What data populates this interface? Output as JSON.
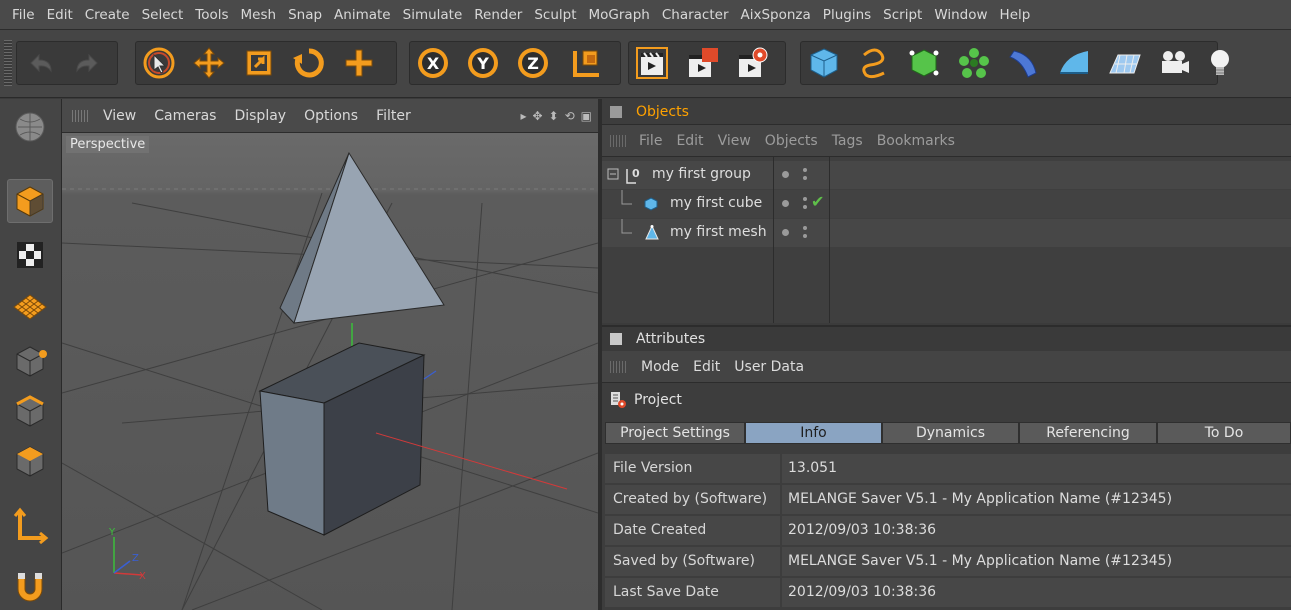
{
  "menubar": [
    "File",
    "Edit",
    "Create",
    "Select",
    "Tools",
    "Mesh",
    "Snap",
    "Animate",
    "Simulate",
    "Render",
    "Sculpt",
    "MoGraph",
    "Character",
    "AixSponza",
    "Plugins",
    "Script",
    "Window",
    "Help"
  ],
  "toolbar": {
    "icons": [
      "undo-icon",
      "redo-icon",
      "live-selection-icon",
      "move-icon",
      "scale-icon",
      "rotate-icon",
      "add-object-icon",
      "x-axis-lock-icon",
      "y-axis-lock-icon",
      "z-axis-lock-icon",
      "coordinate-system-icon",
      "render-view-icon",
      "render-picture-viewer-icon",
      "render-settings-icon",
      "cube-primitive-icon",
      "spline-pen-icon",
      "nurbs-icon",
      "array-icon",
      "deformer-icon",
      "environment-icon",
      "floor-icon",
      "camera-icon",
      "light-icon"
    ],
    "accent": "#f39c1e"
  },
  "leftbar": {
    "icons": [
      "make-editable-icon",
      "model-mode-icon",
      "texture-mode-icon",
      "workplane-icon",
      "points-mode-icon",
      "edges-mode-icon",
      "polygons-mode-icon",
      "enable-axis-icon",
      "snap-icon"
    ]
  },
  "viewport": {
    "menu": [
      "View",
      "Cameras",
      "Display",
      "Options",
      "Filter"
    ],
    "label": "Perspective",
    "axes": {
      "x": "X",
      "y": "Y",
      "z": "Z"
    }
  },
  "objects": {
    "title": "Objects",
    "menu": [
      "File",
      "Edit",
      "View",
      "Objects",
      "Tags",
      "Bookmarks"
    ],
    "items": [
      {
        "name": "my first group",
        "icon": "null-group-icon",
        "checked": false
      },
      {
        "name": "my first cube",
        "icon": "cube-icon",
        "checked": true
      },
      {
        "name": "my first mesh",
        "icon": "polygon-mesh-icon",
        "checked": false
      }
    ]
  },
  "attributes": {
    "title": "Attributes",
    "menu": [
      "Mode",
      "Edit",
      "User Data"
    ],
    "object": "Project",
    "tabs": [
      "Project Settings",
      "Info",
      "Dynamics",
      "Referencing",
      "To Do"
    ],
    "active_tab": "Info",
    "fields": [
      {
        "label": "File Version",
        "value": "13.051"
      },
      {
        "label": "Created by (Software)",
        "value": "MELANGE Saver V5.1 - My Application Name (#12345)"
      },
      {
        "label": "Date Created",
        "value": "2012/09/03 10:38:36"
      },
      {
        "label": "Saved by (Software)",
        "value": "MELANGE Saver V5.1 - My Application Name (#12345)"
      },
      {
        "label": "Last Save Date",
        "value": "2012/09/03 10:38:36"
      }
    ]
  },
  "colors": {
    "accent_orange": "#f39c1e",
    "active_tab": "#8aa4c2",
    "check_green": "#5fbf4a",
    "axis_x": "#d23a3a",
    "axis_y": "#3bbf3b",
    "axis_z": "#3a5fd2"
  }
}
